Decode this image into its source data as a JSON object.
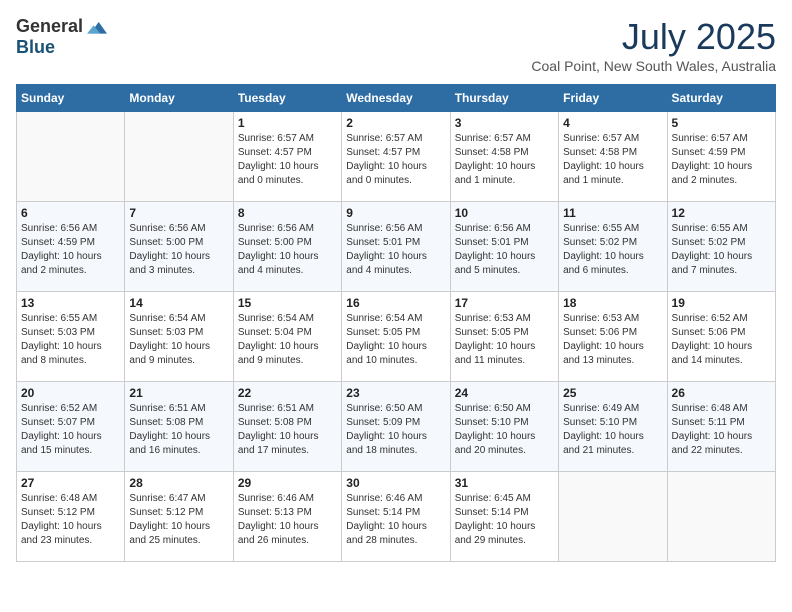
{
  "header": {
    "logo_general": "General",
    "logo_blue": "Blue",
    "month_title": "July 2025",
    "location": "Coal Point, New South Wales, Australia"
  },
  "calendar": {
    "days_of_week": [
      "Sunday",
      "Monday",
      "Tuesday",
      "Wednesday",
      "Thursday",
      "Friday",
      "Saturday"
    ],
    "weeks": [
      [
        {
          "day": "",
          "info": ""
        },
        {
          "day": "",
          "info": ""
        },
        {
          "day": "1",
          "info": "Sunrise: 6:57 AM\nSunset: 4:57 PM\nDaylight: 10 hours\nand 0 minutes."
        },
        {
          "day": "2",
          "info": "Sunrise: 6:57 AM\nSunset: 4:57 PM\nDaylight: 10 hours\nand 0 minutes."
        },
        {
          "day": "3",
          "info": "Sunrise: 6:57 AM\nSunset: 4:58 PM\nDaylight: 10 hours\nand 1 minute."
        },
        {
          "day": "4",
          "info": "Sunrise: 6:57 AM\nSunset: 4:58 PM\nDaylight: 10 hours\nand 1 minute."
        },
        {
          "day": "5",
          "info": "Sunrise: 6:57 AM\nSunset: 4:59 PM\nDaylight: 10 hours\nand 2 minutes."
        }
      ],
      [
        {
          "day": "6",
          "info": "Sunrise: 6:56 AM\nSunset: 4:59 PM\nDaylight: 10 hours\nand 2 minutes."
        },
        {
          "day": "7",
          "info": "Sunrise: 6:56 AM\nSunset: 5:00 PM\nDaylight: 10 hours\nand 3 minutes."
        },
        {
          "day": "8",
          "info": "Sunrise: 6:56 AM\nSunset: 5:00 PM\nDaylight: 10 hours\nand 4 minutes."
        },
        {
          "day": "9",
          "info": "Sunrise: 6:56 AM\nSunset: 5:01 PM\nDaylight: 10 hours\nand 4 minutes."
        },
        {
          "day": "10",
          "info": "Sunrise: 6:56 AM\nSunset: 5:01 PM\nDaylight: 10 hours\nand 5 minutes."
        },
        {
          "day": "11",
          "info": "Sunrise: 6:55 AM\nSunset: 5:02 PM\nDaylight: 10 hours\nand 6 minutes."
        },
        {
          "day": "12",
          "info": "Sunrise: 6:55 AM\nSunset: 5:02 PM\nDaylight: 10 hours\nand 7 minutes."
        }
      ],
      [
        {
          "day": "13",
          "info": "Sunrise: 6:55 AM\nSunset: 5:03 PM\nDaylight: 10 hours\nand 8 minutes."
        },
        {
          "day": "14",
          "info": "Sunrise: 6:54 AM\nSunset: 5:03 PM\nDaylight: 10 hours\nand 9 minutes."
        },
        {
          "day": "15",
          "info": "Sunrise: 6:54 AM\nSunset: 5:04 PM\nDaylight: 10 hours\nand 9 minutes."
        },
        {
          "day": "16",
          "info": "Sunrise: 6:54 AM\nSunset: 5:05 PM\nDaylight: 10 hours\nand 10 minutes."
        },
        {
          "day": "17",
          "info": "Sunrise: 6:53 AM\nSunset: 5:05 PM\nDaylight: 10 hours\nand 11 minutes."
        },
        {
          "day": "18",
          "info": "Sunrise: 6:53 AM\nSunset: 5:06 PM\nDaylight: 10 hours\nand 13 minutes."
        },
        {
          "day": "19",
          "info": "Sunrise: 6:52 AM\nSunset: 5:06 PM\nDaylight: 10 hours\nand 14 minutes."
        }
      ],
      [
        {
          "day": "20",
          "info": "Sunrise: 6:52 AM\nSunset: 5:07 PM\nDaylight: 10 hours\nand 15 minutes."
        },
        {
          "day": "21",
          "info": "Sunrise: 6:51 AM\nSunset: 5:08 PM\nDaylight: 10 hours\nand 16 minutes."
        },
        {
          "day": "22",
          "info": "Sunrise: 6:51 AM\nSunset: 5:08 PM\nDaylight: 10 hours\nand 17 minutes."
        },
        {
          "day": "23",
          "info": "Sunrise: 6:50 AM\nSunset: 5:09 PM\nDaylight: 10 hours\nand 18 minutes."
        },
        {
          "day": "24",
          "info": "Sunrise: 6:50 AM\nSunset: 5:10 PM\nDaylight: 10 hours\nand 20 minutes."
        },
        {
          "day": "25",
          "info": "Sunrise: 6:49 AM\nSunset: 5:10 PM\nDaylight: 10 hours\nand 21 minutes."
        },
        {
          "day": "26",
          "info": "Sunrise: 6:48 AM\nSunset: 5:11 PM\nDaylight: 10 hours\nand 22 minutes."
        }
      ],
      [
        {
          "day": "27",
          "info": "Sunrise: 6:48 AM\nSunset: 5:12 PM\nDaylight: 10 hours\nand 23 minutes."
        },
        {
          "day": "28",
          "info": "Sunrise: 6:47 AM\nSunset: 5:12 PM\nDaylight: 10 hours\nand 25 minutes."
        },
        {
          "day": "29",
          "info": "Sunrise: 6:46 AM\nSunset: 5:13 PM\nDaylight: 10 hours\nand 26 minutes."
        },
        {
          "day": "30",
          "info": "Sunrise: 6:46 AM\nSunset: 5:14 PM\nDaylight: 10 hours\nand 28 minutes."
        },
        {
          "day": "31",
          "info": "Sunrise: 6:45 AM\nSunset: 5:14 PM\nDaylight: 10 hours\nand 29 minutes."
        },
        {
          "day": "",
          "info": ""
        },
        {
          "day": "",
          "info": ""
        }
      ]
    ]
  }
}
